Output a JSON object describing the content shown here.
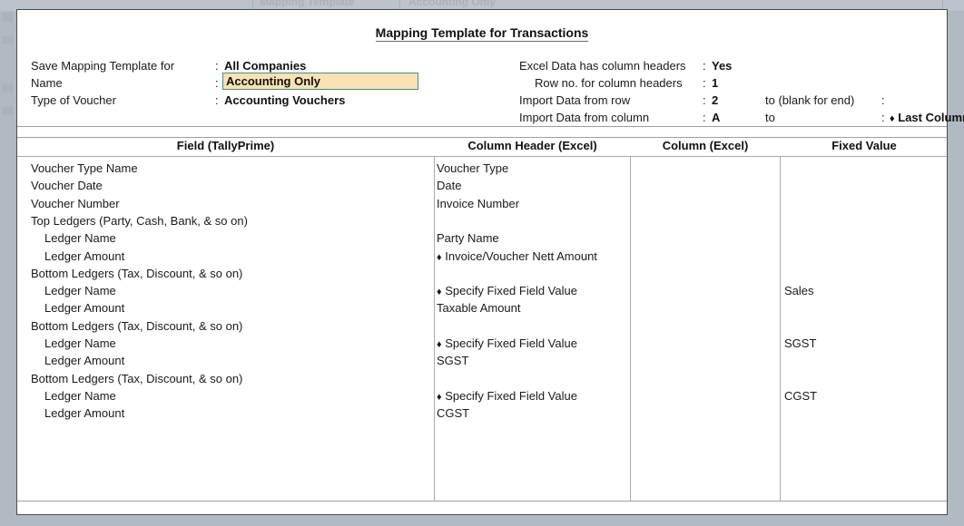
{
  "background": {
    "ghost_tab_1": "Mapping Template",
    "ghost_tab_2": "Accounting Only"
  },
  "dialog": {
    "title": "Mapping Template for Transactions",
    "colon": ":",
    "params_left": [
      {
        "label": "Save Mapping Template for",
        "value": "All Companies"
      },
      {
        "label": "Name",
        "value": "Accounting Only"
      },
      {
        "label": "Type of Voucher",
        "value": "Accounting Vouchers"
      }
    ],
    "params_right": [
      {
        "label": "Excel Data has column headers",
        "value": "Yes"
      },
      {
        "label": "Row no. for column headers",
        "value": "1"
      },
      {
        "label": "Import Data from row",
        "value": "2",
        "to_label": "to (blank for end)",
        "to_value": ""
      },
      {
        "label": "Import Data from column",
        "value": "A",
        "to_label": "to",
        "to_value": "Last Column"
      }
    ],
    "name_field": {
      "value": "Accounting Only",
      "background_color": "#fbe2b4",
      "border_color": "#3f8f8f"
    }
  },
  "grid": {
    "columns": [
      "Field (TallyPrime)",
      "Column Header (Excel)",
      "Column (Excel)",
      "Fixed Value"
    ],
    "rows": [
      {
        "field": "Voucher Type Name",
        "indent": false,
        "column_header": "Voucher Type",
        "diamond": false,
        "column_excel": "",
        "fixed_value": ""
      },
      {
        "field": "Voucher Date",
        "indent": false,
        "column_header": "Date",
        "diamond": false,
        "column_excel": "",
        "fixed_value": ""
      },
      {
        "field": "Voucher Number",
        "indent": false,
        "column_header": "Invoice Number",
        "diamond": false,
        "column_excel": "",
        "fixed_value": ""
      },
      {
        "field": "Top Ledgers (Party, Cash, Bank, & so on)",
        "indent": false,
        "column_header": "",
        "diamond": false,
        "column_excel": "",
        "fixed_value": ""
      },
      {
        "field": "Ledger Name",
        "indent": true,
        "column_header": "Party Name",
        "diamond": false,
        "column_excel": "",
        "fixed_value": ""
      },
      {
        "field": "Ledger Amount",
        "indent": true,
        "column_header": "Invoice/Voucher Nett Amount",
        "diamond": true,
        "column_excel": "",
        "fixed_value": ""
      },
      {
        "field": "Bottom Ledgers (Tax, Discount, & so on)",
        "indent": false,
        "column_header": "",
        "diamond": false,
        "column_excel": "",
        "fixed_value": ""
      },
      {
        "field": "Ledger Name",
        "indent": true,
        "column_header": "Specify Fixed Field Value",
        "diamond": true,
        "column_excel": "",
        "fixed_value": "Sales"
      },
      {
        "field": "Ledger Amount",
        "indent": true,
        "column_header": "Taxable Amount",
        "diamond": false,
        "column_excel": "",
        "fixed_value": ""
      },
      {
        "field": "Bottom Ledgers (Tax, Discount, & so on)",
        "indent": false,
        "column_header": "",
        "diamond": false,
        "column_excel": "",
        "fixed_value": ""
      },
      {
        "field": "Ledger Name",
        "indent": true,
        "column_header": "Specify Fixed Field Value",
        "diamond": true,
        "column_excel": "",
        "fixed_value": "SGST"
      },
      {
        "field": "Ledger Amount",
        "indent": true,
        "column_header": "SGST",
        "diamond": false,
        "column_excel": "",
        "fixed_value": ""
      },
      {
        "field": "Bottom Ledgers (Tax, Discount, & so on)",
        "indent": false,
        "column_header": "",
        "diamond": false,
        "column_excel": "",
        "fixed_value": ""
      },
      {
        "field": "Ledger Name",
        "indent": true,
        "column_header": "Specify Fixed Field Value",
        "diamond": true,
        "column_excel": "",
        "fixed_value": "CGST"
      },
      {
        "field": "Ledger Amount",
        "indent": true,
        "column_header": "CGST",
        "diamond": false,
        "column_excel": "",
        "fixed_value": ""
      }
    ]
  },
  "symbols": {
    "diamond": "♦"
  }
}
